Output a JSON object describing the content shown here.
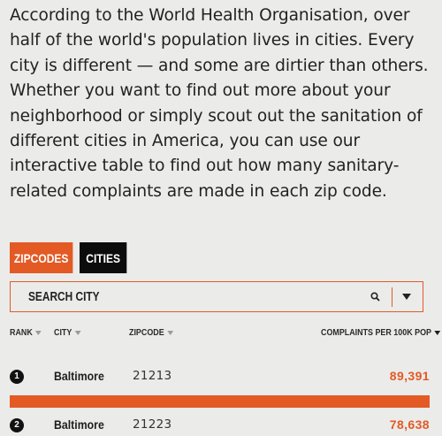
{
  "intro": {
    "text": "According to the World Health Organisation, over half of the world's population lives in cities. Every city is different — and some are dirtier than others. Whether you want to find out more about your neighborhood or simply scout out the sanitation of different cities in America, you can use our interactive table to find out how many sanitary-related complaints are made in each zip code."
  },
  "tabs": [
    {
      "label": "ZIPCODES",
      "active": true
    },
    {
      "label": "CITIES",
      "active": false
    }
  ],
  "search": {
    "placeholder": "SEARCH CITY",
    "icon": "search-icon",
    "dropdown_icon": "caret-down-icon"
  },
  "table": {
    "columns": [
      {
        "label": "RANK"
      },
      {
        "label": "CITY"
      },
      {
        "label": "ZIPCODE"
      },
      {
        "label": "COMPLAINTS PER 100K POP"
      }
    ],
    "rows": [
      {
        "rank": "1",
        "city": "Baltimore",
        "zip": "21213",
        "value": "89,391",
        "bar_fraction": 1.0
      },
      {
        "rank": "2",
        "city": "Baltimore",
        "zip": "21223",
        "value": "78,638",
        "bar_fraction": 0.88
      }
    ]
  },
  "colors": {
    "accent": "#e35a25",
    "dark": "#0c0c0c",
    "background": "#ebebea"
  }
}
